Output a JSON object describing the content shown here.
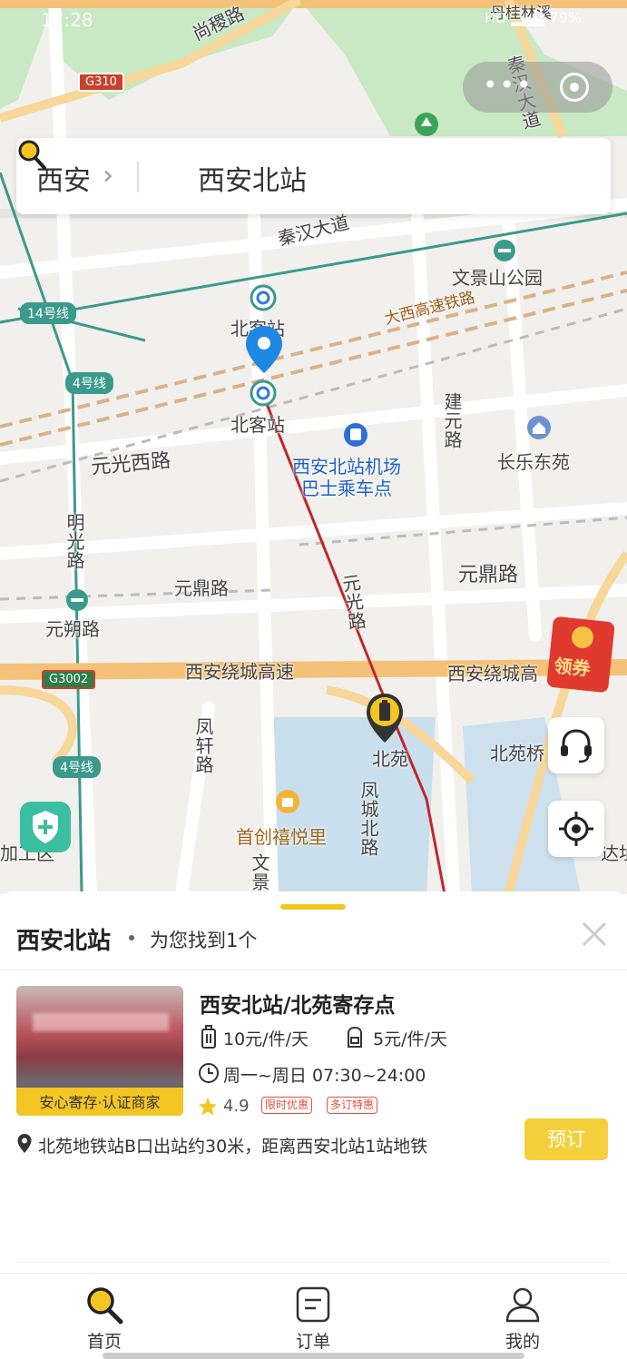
{
  "status_bar": {
    "time": "17:28",
    "icons": "HD ▂▄▆ 79%"
  },
  "search": {
    "city": "西安",
    "query": "西安北站"
  },
  "map": {
    "labels": {
      "shangji_road": "尚稷路",
      "qinhan_avenue_top": "秦汉大道",
      "qinhan_avenue": "秦汉大道",
      "wenjingshan_park": "文景山公园",
      "daxi_railway": "大西高速铁路",
      "beike_station_1": "北客站",
      "beike_station_2": "北客站",
      "jianyuan_road": "建元路",
      "changle_dongyuan": "长乐东苑",
      "yuanguang_west_road": "元光西路",
      "airport_bus": "西安北站机场\n巴士乘车点",
      "mingguang_road": "明光路",
      "yuanding_road_left": "元鼎路",
      "yuanding_road_right": "元鼎路",
      "yuanguang_road": "元光路",
      "yuanshuo_road": "元朔路",
      "ring_expressway_left": "西安绕城高速",
      "ring_expressway_right": "西安绕城高",
      "fengxuan_road": "凤轩路",
      "beiyuan": "北苑",
      "beiyuan_bridge": "北苑桥",
      "fengcheng_north_road": "凤城北路",
      "shouchuang_xiyueli": "首创禧悦里",
      "wen_partial": "文景",
      "top_partial": "丹桂林溪",
      "left_partial": "加工区",
      "right_partial": "达址"
    },
    "badges": {
      "line14": "14号线",
      "line4_top": "4号线",
      "line4_bottom": "4号线",
      "g310": "G310",
      "g3002": "G3002"
    },
    "coupon_label": "领券"
  },
  "results": {
    "title": "西安北站",
    "count_text": "为您找到1个",
    "store": {
      "name": "西安北站/北苑寄存点",
      "badge": "安心寄存·认证商家",
      "price_luggage": "10元/件/天",
      "price_bag": "5元/件/天",
      "hours": "周一~周日 07:30~24:00",
      "rating": "4.9",
      "tags": [
        "限时优惠",
        "多订特惠"
      ],
      "address": "北苑地铁站B口出站约30米，距离西安北站1站地铁",
      "book_label": "预订"
    }
  },
  "tabs": [
    {
      "label": "首页",
      "icon": "search-icon"
    },
    {
      "label": "订单",
      "icon": "order-icon"
    },
    {
      "label": "我的",
      "icon": "user-icon"
    }
  ],
  "colors": {
    "accent": "#f3c623",
    "map_pin": "#1e88e5",
    "metro": "#3a9a8c",
    "tag_red": "#e0503f"
  }
}
